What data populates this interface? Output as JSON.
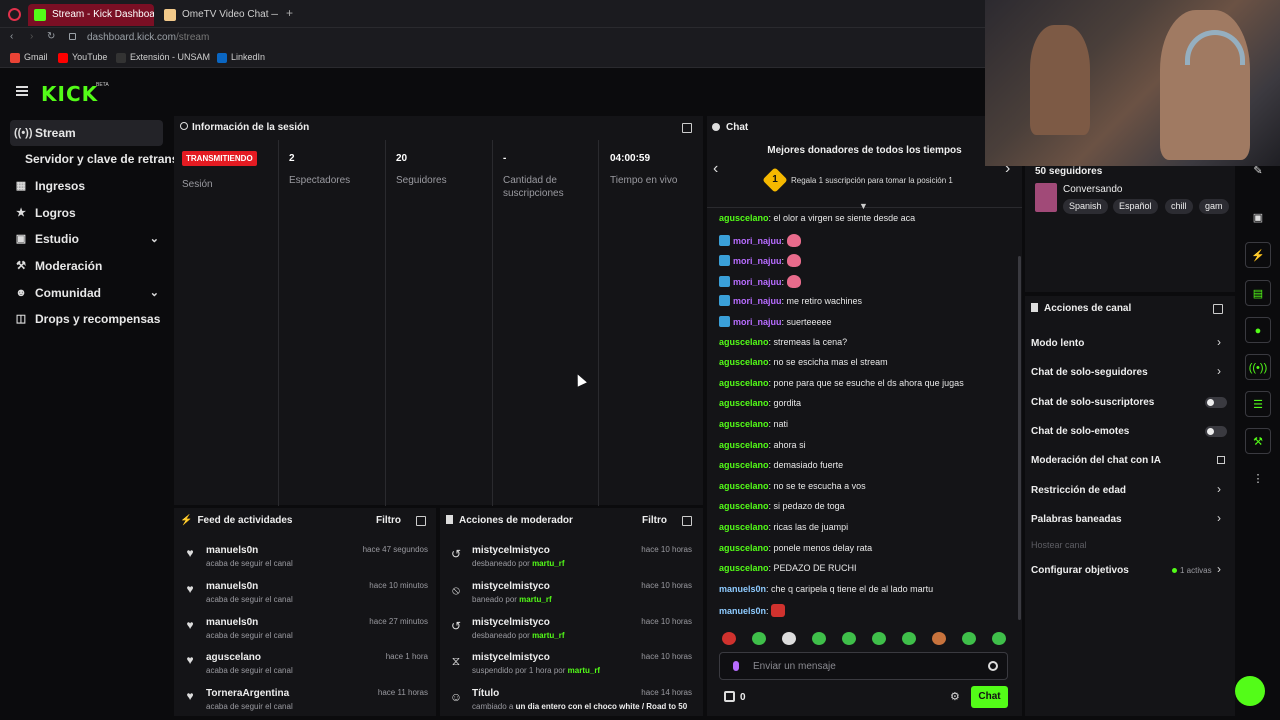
{
  "browser": {
    "tabs": [
      {
        "title": "Stream - Kick Dashboard",
        "active": true
      },
      {
        "title": "OmeTV Video Chat — Ome",
        "active": false
      }
    ],
    "url_host": "dashboard.kick.com",
    "url_path": "/stream",
    "bookmarks": [
      "Gmail",
      "YouTube",
      "Extensión - UNSAM",
      "LinkedIn"
    ]
  },
  "brand": {
    "logo": "KICK",
    "beta": "BETA",
    "accent": "#53fc18"
  },
  "sidebar": {
    "items": [
      {
        "label": "Stream",
        "icon": "broadcast-icon"
      },
      {
        "label": "Servidor y clave de retransm",
        "icon": ""
      },
      {
        "label": "Ingresos",
        "icon": "chart-icon"
      },
      {
        "label": "Logros",
        "icon": "trophy-icon"
      },
      {
        "label": "Estudio",
        "icon": "grid-icon"
      },
      {
        "label": "Moderación",
        "icon": "wrench-icon"
      },
      {
        "label": "Comunidad",
        "icon": "people-icon"
      },
      {
        "label": "Drops y recompensas",
        "icon": "gift-icon"
      }
    ]
  },
  "session": {
    "title": "Información de la sesión",
    "live_badge": "TRANSMITIENDO",
    "session_label": "Sesión",
    "stats": [
      {
        "value": "2",
        "label": "Espectadores"
      },
      {
        "value": "20",
        "label": "Seguidores"
      },
      {
        "value": "-",
        "label": "Cantidad de suscripciones"
      },
      {
        "value": "04:00:59",
        "label": "Tiempo en vivo"
      }
    ]
  },
  "activity": {
    "title": "Feed de actividades",
    "filter": "Filtro",
    "rows": [
      {
        "name": "manuels0n",
        "sub": "acaba de seguir el canal",
        "time": "hace 47 segundos"
      },
      {
        "name": "manuels0n",
        "sub": "acaba de seguir el canal",
        "time": "hace 10 minutos"
      },
      {
        "name": "manuels0n",
        "sub": "acaba de seguir el canal",
        "time": "hace 27 minutos"
      },
      {
        "name": "aguscelano",
        "sub": "acaba de seguir el canal",
        "time": "hace 1 hora"
      },
      {
        "name": "TorneraArgentina",
        "sub": "acaba de seguir el canal",
        "time": "hace 11 horas"
      }
    ]
  },
  "modactions": {
    "title": "Acciones de moderador",
    "filter": "Filtro",
    "rows": [
      {
        "name": "mistycelmistyco",
        "sub_pre": "desbaneado por",
        "sub_user": "martu_rf",
        "sub_post": "",
        "time": "hace 10 horas",
        "icon": "undo-icon"
      },
      {
        "name": "mistycelmistyco",
        "sub_pre": "baneado por",
        "sub_user": "martu_rf",
        "sub_post": "",
        "time": "hace 10 horas",
        "icon": "ban-icon"
      },
      {
        "name": "mistycelmistyco",
        "sub_pre": "desbaneado por",
        "sub_user": "martu_rf",
        "sub_post": "",
        "time": "hace 10 horas",
        "icon": "undo-icon"
      },
      {
        "name": "mistycelmistyco",
        "sub_pre": "suspendido por 1 hora por",
        "sub_user": "martu_rf",
        "sub_post": "",
        "time": "hace 10 horas",
        "icon": "hourglass-icon"
      },
      {
        "name": "Título",
        "sub_pre": "cambiado a",
        "sub_user": "un dia entero con el choco white / Road to 50",
        "sub_post": "",
        "time": "hace 14 horas",
        "icon": "title-icon"
      }
    ]
  },
  "chat": {
    "title": "Chat",
    "donors_title": "Mejores donadores de todos los tiempos",
    "donors_rank": "1",
    "donors_cta": "Regala 1 suscripción para tomar la posición 1",
    "messages": [
      {
        "user": "aguscelano",
        "color": "#53fc18",
        "badge": false,
        "text": "el olor a virgen se siente desde aca",
        "emote": ""
      },
      {
        "user": "mori_najuu",
        "color": "#b76cff",
        "badge": true,
        "text": "",
        "emote": "pink"
      },
      {
        "user": "mori_najuu",
        "color": "#b76cff",
        "badge": true,
        "text": "",
        "emote": "pink"
      },
      {
        "user": "mori_najuu",
        "color": "#b76cff",
        "badge": true,
        "text": "",
        "emote": "pink"
      },
      {
        "user": "mori_najuu",
        "color": "#b76cff",
        "badge": true,
        "text": "me retiro wachines",
        "emote": ""
      },
      {
        "user": "mori_najuu",
        "color": "#b76cff",
        "badge": true,
        "text": "suerteeeee",
        "emote": ""
      },
      {
        "user": "aguscelano",
        "color": "#53fc18",
        "badge": false,
        "text": "stremeas la cena?",
        "emote": ""
      },
      {
        "user": "aguscelano",
        "color": "#53fc18",
        "badge": false,
        "text": "no se escicha mas el stream",
        "emote": ""
      },
      {
        "user": "aguscelano",
        "color": "#53fc18",
        "badge": false,
        "text": "pone para que se esuche el ds ahora que jugas",
        "emote": ""
      },
      {
        "user": "aguscelano",
        "color": "#53fc18",
        "badge": false,
        "text": "gordita",
        "emote": ""
      },
      {
        "user": "aguscelano",
        "color": "#53fc18",
        "badge": false,
        "text": "nati",
        "emote": ""
      },
      {
        "user": "aguscelano",
        "color": "#53fc18",
        "badge": false,
        "text": "ahora si",
        "emote": ""
      },
      {
        "user": "aguscelano",
        "color": "#53fc18",
        "badge": false,
        "text": "demasiado fuerte",
        "emote": ""
      },
      {
        "user": "aguscelano",
        "color": "#53fc18",
        "badge": false,
        "text": "no se te escucha a vos",
        "emote": ""
      },
      {
        "user": "aguscelano",
        "color": "#53fc18",
        "badge": false,
        "text": "si pedazo de toga",
        "emote": ""
      },
      {
        "user": "aguscelano",
        "color": "#53fc18",
        "badge": false,
        "text": "ricas las de juampi",
        "emote": ""
      },
      {
        "user": "aguscelano",
        "color": "#53fc18",
        "badge": false,
        "text": "ponele menos delay rata",
        "emote": ""
      },
      {
        "user": "aguscelano",
        "color": "#53fc18",
        "badge": false,
        "text": "PEDAZO DE RUCHI",
        "emote": ""
      },
      {
        "user": "manuels0n",
        "color": "#8ecbff",
        "badge": false,
        "text": "che q caripela q tiene el de al lado martu",
        "emote": ""
      },
      {
        "user": "manuels0n",
        "color": "#8ecbff",
        "badge": false,
        "text": "",
        "emote": "red"
      }
    ],
    "input_placeholder": "Enviar un mensaje",
    "points": "0",
    "send_label": "Chat"
  },
  "stream_info": {
    "followers": "50 seguidores",
    "category": "Conversando",
    "tags": [
      "Spanish",
      "Español",
      "chill",
      "gam"
    ]
  },
  "channel_actions": {
    "title": "Acciones de canal",
    "items": [
      {
        "label": "Modo lento",
        "control": "chevron"
      },
      {
        "label": "Chat de solo-seguidores",
        "control": "chevron"
      },
      {
        "label": "Chat de solo-suscriptores",
        "control": "toggle"
      },
      {
        "label": "Chat de solo-emotes",
        "control": "toggle"
      },
      {
        "label": "Moderación del chat con IA",
        "control": "external"
      },
      {
        "label": "Restricción de edad",
        "control": "chevron"
      },
      {
        "label": "Palabras baneadas",
        "control": "chevron"
      },
      {
        "label": "Hostear canal",
        "control": "none"
      },
      {
        "label": "Configurar objetivos",
        "control": "chevron"
      }
    ],
    "goals_active": "1 activas"
  }
}
